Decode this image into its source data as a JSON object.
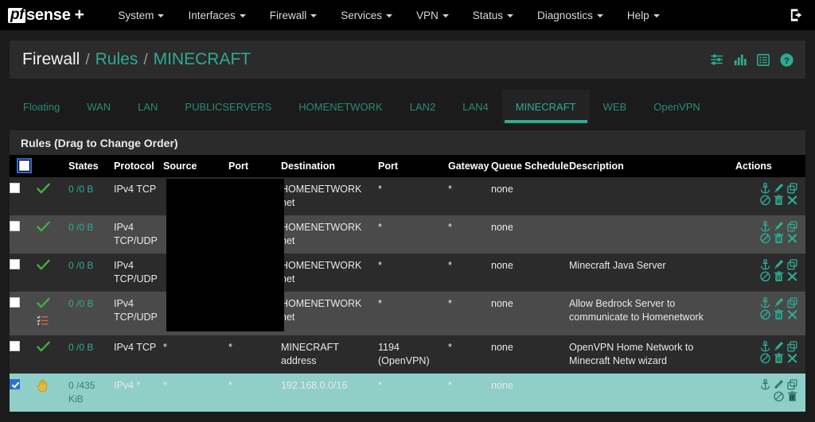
{
  "navbar": {
    "brand_pf": "pf",
    "brand_sense": "sense",
    "brand_plus": "+",
    "items": [
      {
        "label": "System"
      },
      {
        "label": "Interfaces"
      },
      {
        "label": "Firewall"
      },
      {
        "label": "Services"
      },
      {
        "label": "VPN"
      },
      {
        "label": "Status"
      },
      {
        "label": "Diagnostics"
      },
      {
        "label": "Help"
      }
    ],
    "logout_icon": "logout-icon"
  },
  "header": {
    "crumb1": "Firewall",
    "sep": "/",
    "crumb2": "Rules",
    "crumb3": "MINECRAFT",
    "icons": [
      "sliders-icon",
      "bar-chart-icon",
      "list-table-icon",
      "help-circle-icon"
    ]
  },
  "tabs": [
    {
      "label": "Floating",
      "active": false
    },
    {
      "label": "WAN",
      "active": false
    },
    {
      "label": "LAN",
      "active": false
    },
    {
      "label": "PUBLICSERVERS",
      "active": false
    },
    {
      "label": "HOMENETWORK",
      "active": false
    },
    {
      "label": "LAN2",
      "active": false
    },
    {
      "label": "LAN4",
      "active": false
    },
    {
      "label": "MINECRAFT",
      "active": true
    },
    {
      "label": "WEB",
      "active": false
    },
    {
      "label": "OpenVPN",
      "active": false
    }
  ],
  "panel": {
    "title": "Rules (Drag to Change Order)",
    "columns": {
      "states": "States",
      "protocol": "Protocol",
      "source": "Source",
      "port": "Port",
      "destination": "Destination",
      "dport": "Port",
      "gateway": "Gateway",
      "queue": "Queue",
      "schedule": "Schedule",
      "description": "Description",
      "actions": "Actions"
    }
  },
  "rows": [
    {
      "checked": false,
      "status_icon": "pass-check-icon",
      "extra_icon": null,
      "states": "0 /0 B",
      "protocol": "IPv4 TCP",
      "source": "",
      "source_redacted": true,
      "port": "",
      "destination": "HOMENETWORK net",
      "dport": "*",
      "gateway": "*",
      "queue": "none",
      "schedule": "",
      "description": "",
      "actions": [
        "anchor-icon",
        "edit-pencil-icon",
        "copy-icon",
        "block-icon",
        "delete-trash-icon",
        "remove-x-icon"
      ],
      "shade": "a"
    },
    {
      "checked": false,
      "status_icon": "pass-check-icon",
      "extra_icon": null,
      "states": "0 /0 B",
      "protocol": "IPv4 TCP/UDP",
      "source": "",
      "source_redacted": true,
      "port": "",
      "destination": "HOMENETWORK net",
      "dport": "*",
      "gateway": "*",
      "queue": "none",
      "schedule": "",
      "description": "",
      "actions": [
        "anchor-icon",
        "edit-pencil-icon",
        "copy-icon",
        "block-icon",
        "delete-trash-icon",
        "remove-x-icon"
      ],
      "shade": "b"
    },
    {
      "checked": false,
      "status_icon": "pass-check-icon",
      "extra_icon": null,
      "states": "0 /0 B",
      "protocol": "IPv4 TCP/UDP",
      "source": "",
      "source_redacted": true,
      "port": "",
      "destination": "HOMENETWORK net",
      "dport": "*",
      "gateway": "*",
      "queue": "none",
      "schedule": "",
      "description": "Minecraft Java Server",
      "actions": [
        "anchor-icon",
        "edit-pencil-icon",
        "copy-icon",
        "block-icon",
        "delete-trash-icon",
        "remove-x-icon"
      ],
      "shade": "a"
    },
    {
      "checked": false,
      "status_icon": "pass-check-icon",
      "extra_icon": "advanced-options-icon",
      "states": "0 /0 B",
      "protocol": "IPv4 TCP/UDP",
      "source": "",
      "source_redacted": true,
      "port": "",
      "destination": "HOMENETWORK net",
      "dport": "*",
      "gateway": "*",
      "queue": "none",
      "schedule": "",
      "description": "Allow Bedrock Server to communicate to Homenetwork",
      "actions": [
        "anchor-icon",
        "edit-pencil-icon",
        "copy-icon",
        "block-icon",
        "delete-trash-icon",
        "remove-x-icon"
      ],
      "shade": "b"
    },
    {
      "checked": false,
      "status_icon": "pass-check-icon",
      "extra_icon": null,
      "states": "0 /0 B",
      "protocol": "IPv4 TCP",
      "source": "*",
      "source_redacted": false,
      "port": "*",
      "destination": "MINECRAFT address",
      "dport": "1194 (OpenVPN)",
      "gateway": "*",
      "queue": "none",
      "schedule": "",
      "description": "OpenVPN Home Network to Minecraft Netw wizard",
      "actions": [
        "anchor-icon",
        "edit-pencil-icon",
        "copy-icon",
        "block-icon",
        "delete-trash-icon",
        "remove-x-icon"
      ],
      "shade": "a"
    },
    {
      "checked": true,
      "status_icon": "reject-hand-icon",
      "extra_icon": null,
      "states": "0 /435 KiB",
      "protocol": "IPv4 *",
      "source": "*",
      "source_redacted": false,
      "port": "*",
      "destination": "192.168.0.0/16",
      "dport": "*",
      "gateway": "*",
      "queue": "none",
      "schedule": "",
      "description": "",
      "actions": [
        "anchor-icon",
        "edit-pencil-icon",
        "copy-icon",
        "block-icon",
        "delete-trash-icon"
      ],
      "shade": "sel"
    }
  ]
}
